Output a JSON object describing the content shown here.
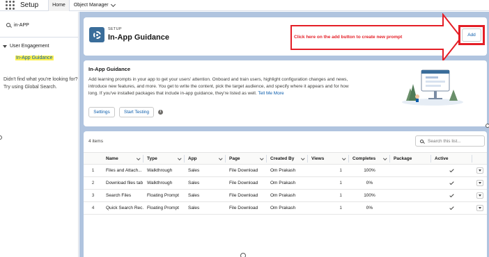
{
  "topnav": {
    "app_name": "Setup",
    "tab_home": "Home",
    "tab_object_manager": "Object Manager"
  },
  "sidebar": {
    "quick_find_value": "in-APP",
    "group_label": "User Engagement",
    "item_label": "In-App Guidance",
    "help_line1": "Didn't find what you're looking for?",
    "help_line2": "Try using Global Search."
  },
  "header": {
    "kicker": "SETUP",
    "title": "In-App Guidance",
    "add_label": "Add",
    "annotation": "Click here on the add button to create new prompt"
  },
  "info": {
    "title": "In-App Guidance",
    "body": "Add learning prompts in your app to get your users' attention. Onboard and train users, highlight configuration changes and news, introduce new features, and more. You get to write the content, pick the target audience, and specify where it appears and for how long. If you've installed packages that include in-app guidance, they're listed as well.",
    "link": "Tell Me More",
    "settings_label": "Settings",
    "start_testing_label": "Start Testing",
    "info_glyph": "i"
  },
  "list": {
    "count_label": "4 items",
    "search_placeholder": "Search this list...",
    "columns": [
      "Name",
      "Type",
      "App",
      "Page",
      "Created By",
      "Views",
      "Completes",
      "Package",
      "Active"
    ],
    "rows": [
      {
        "n": "1",
        "name": "Files and Attach...",
        "type": "Walkthrough",
        "app": "Sales",
        "page": "File Download",
        "created_by": "Om Prakash",
        "views": "1",
        "completes": "100%",
        "package": "",
        "active": true
      },
      {
        "n": "2",
        "name": "Download files tab",
        "type": "Walkthrough",
        "app": "Sales",
        "page": "File Download",
        "created_by": "Om Prakash",
        "views": "1",
        "completes": "0%",
        "package": "",
        "active": true
      },
      {
        "n": "3",
        "name": "Search Files",
        "type": "Floating Prompt",
        "app": "Sales",
        "page": "File Download",
        "created_by": "Om Prakash",
        "views": "1",
        "completes": "100%",
        "package": "",
        "active": true
      },
      {
        "n": "4",
        "name": "Quick Search Rec...",
        "type": "Floating Prompt",
        "app": "Sales",
        "page": "File Download",
        "created_by": "Om Prakash",
        "views": "1",
        "completes": "0%",
        "package": "",
        "active": true
      }
    ]
  },
  "colors": {
    "brand_blue": "#0b5cab",
    "annotation_red": "#e41e26",
    "page_background": "#b0c4df",
    "highlight_yellow": "#fff24d"
  },
  "icons": [
    "app-launcher-icon",
    "chevron-down-icon",
    "search-icon",
    "gear-icon",
    "info-icon",
    "checkmark-icon",
    "row-action-icon",
    "arrow-annotation-icon"
  ]
}
